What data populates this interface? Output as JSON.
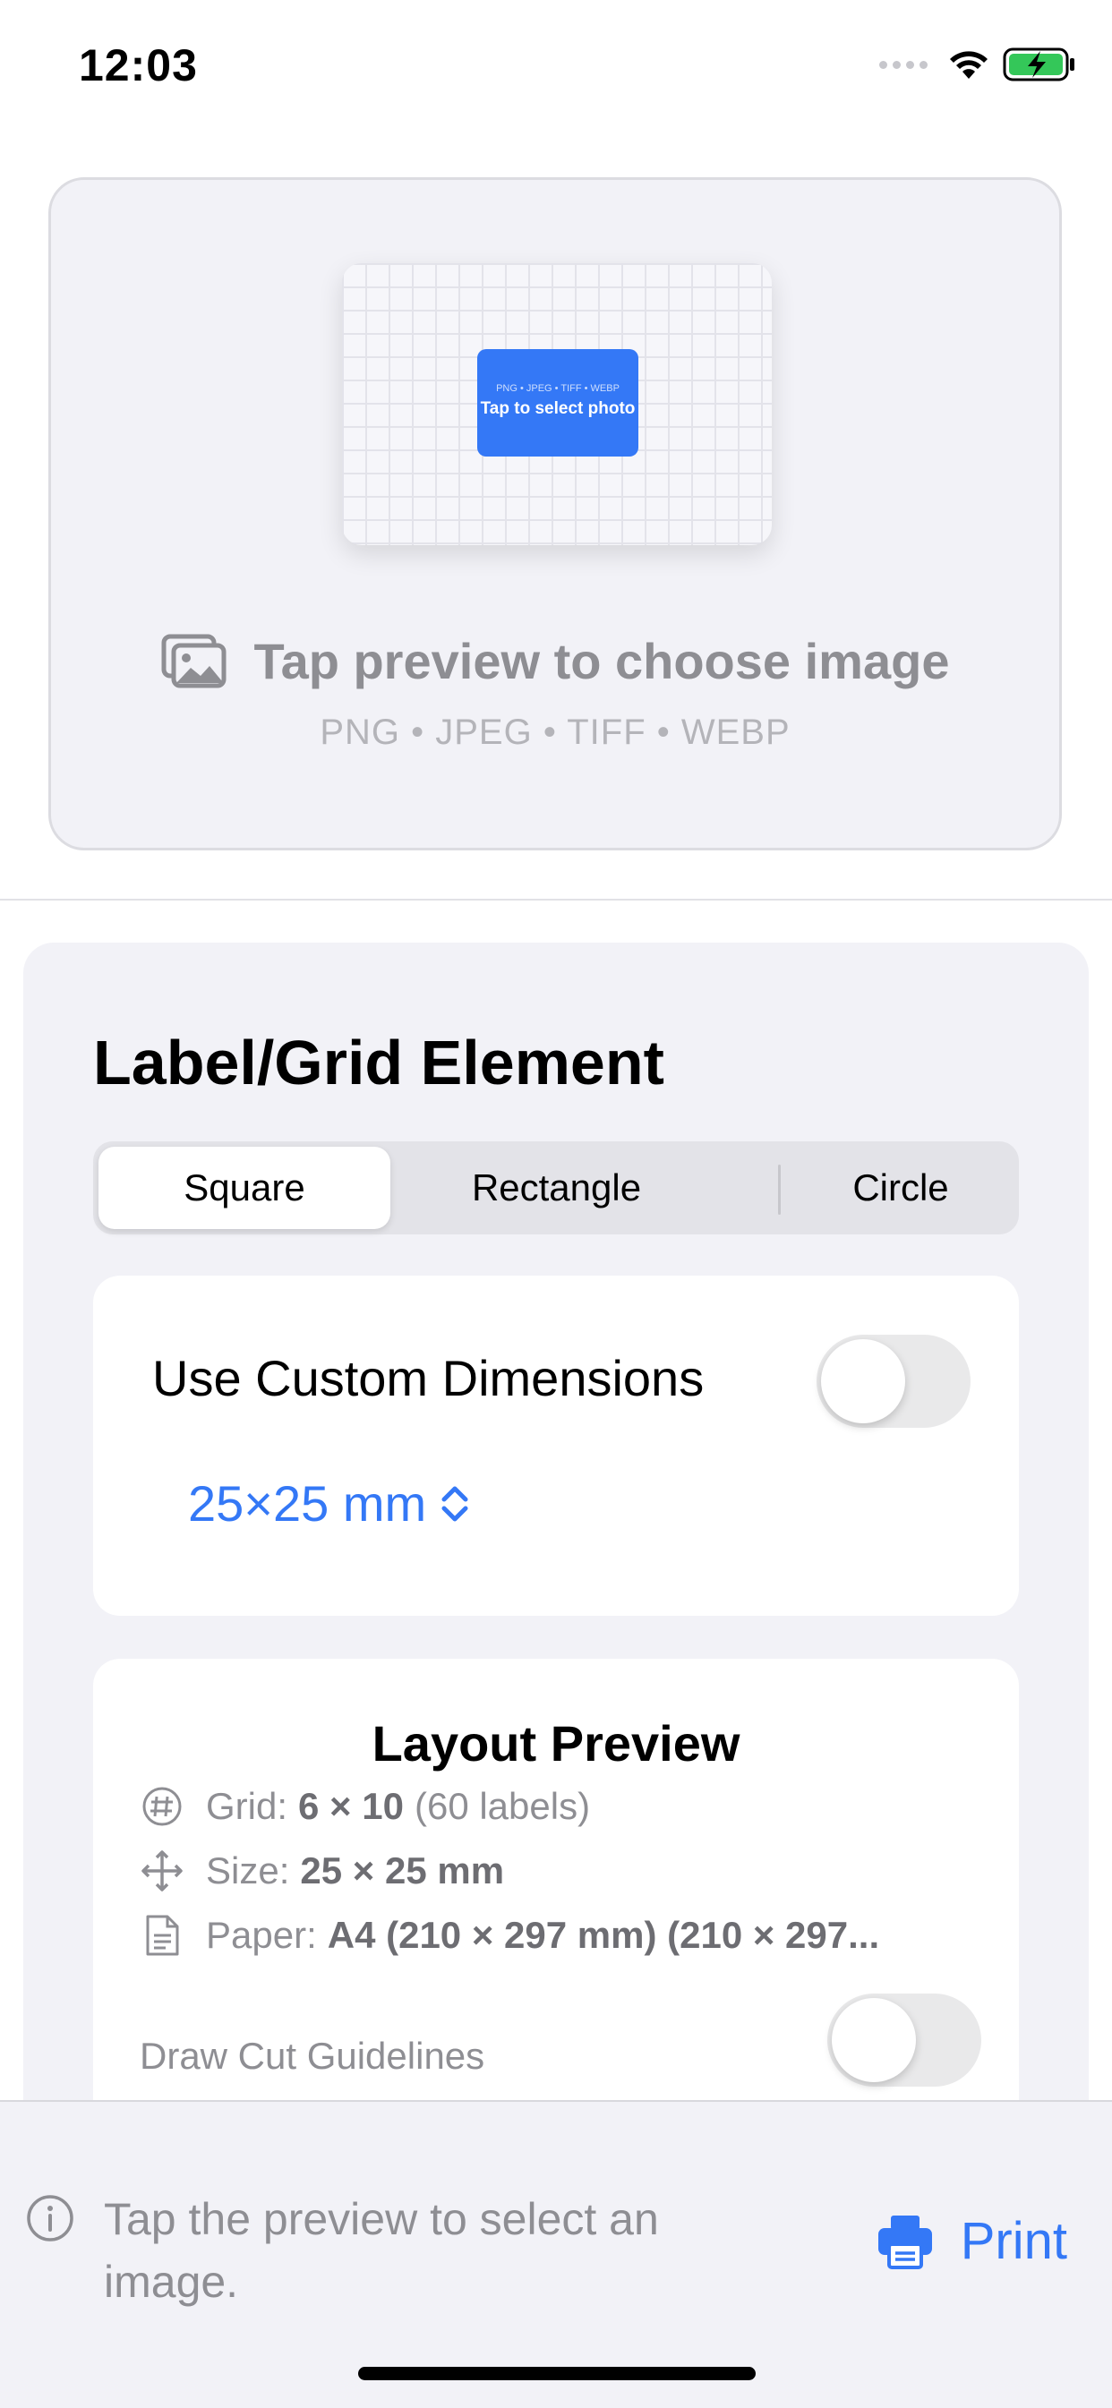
{
  "status_bar": {
    "time": "12:03",
    "icons": [
      "signal-dots-icon",
      "wifi-icon",
      "battery-charging-icon"
    ]
  },
  "upload": {
    "thumbnail_formats": "PNG • JPEG • TIFF • WEBP",
    "thumbnail_button": "Tap to select photo",
    "hint": "Tap preview to choose image",
    "formats": "PNG • JPEG • TIFF • WEBP",
    "icon": "photos-icon"
  },
  "panel": {
    "title": "Label/Grid Element",
    "shapes": [
      "Square",
      "Rectangle",
      "Circle"
    ],
    "selected_shape": "Square",
    "custom_dimensions": {
      "label": "Use Custom Dimensions",
      "enabled": false
    },
    "dimension": "25×25 mm",
    "layout": {
      "title": "Layout Preview",
      "grid_label": "Grid:",
      "grid_value": "6 × 10",
      "grid_extra": "(60 labels)",
      "size_label": "Size:",
      "size_value": "25 × 25 mm",
      "paper_label": "Paper:",
      "paper_value": "A4 (210 × 297 mm) (210 × 297...",
      "cut_guidelines_label": "Draw Cut Guidelines",
      "cut_guidelines_enabled": false
    }
  },
  "bottom_bar": {
    "hint": "Tap the preview to select an image.",
    "print_label": "Print"
  },
  "colors": {
    "accent": "#3478f6",
    "secondary_text": "#8e8e93",
    "panel_bg": "#f2f2f7"
  }
}
